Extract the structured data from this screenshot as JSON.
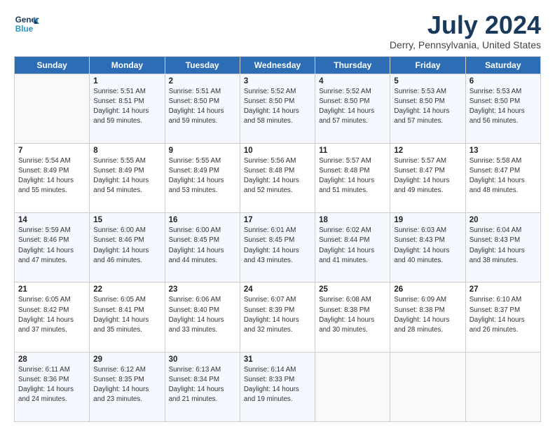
{
  "logo": {
    "line1": "General",
    "line2": "Blue"
  },
  "title": "July 2024",
  "subtitle": "Derry, Pennsylvania, United States",
  "days_of_week": [
    "Sunday",
    "Monday",
    "Tuesday",
    "Wednesday",
    "Thursday",
    "Friday",
    "Saturday"
  ],
  "weeks": [
    [
      {
        "num": "",
        "info": ""
      },
      {
        "num": "1",
        "info": "Sunrise: 5:51 AM\nSunset: 8:51 PM\nDaylight: 14 hours\nand 59 minutes."
      },
      {
        "num": "2",
        "info": "Sunrise: 5:51 AM\nSunset: 8:50 PM\nDaylight: 14 hours\nand 59 minutes."
      },
      {
        "num": "3",
        "info": "Sunrise: 5:52 AM\nSunset: 8:50 PM\nDaylight: 14 hours\nand 58 minutes."
      },
      {
        "num": "4",
        "info": "Sunrise: 5:52 AM\nSunset: 8:50 PM\nDaylight: 14 hours\nand 57 minutes."
      },
      {
        "num": "5",
        "info": "Sunrise: 5:53 AM\nSunset: 8:50 PM\nDaylight: 14 hours\nand 57 minutes."
      },
      {
        "num": "6",
        "info": "Sunrise: 5:53 AM\nSunset: 8:50 PM\nDaylight: 14 hours\nand 56 minutes."
      }
    ],
    [
      {
        "num": "7",
        "info": "Sunrise: 5:54 AM\nSunset: 8:49 PM\nDaylight: 14 hours\nand 55 minutes."
      },
      {
        "num": "8",
        "info": "Sunrise: 5:55 AM\nSunset: 8:49 PM\nDaylight: 14 hours\nand 54 minutes."
      },
      {
        "num": "9",
        "info": "Sunrise: 5:55 AM\nSunset: 8:49 PM\nDaylight: 14 hours\nand 53 minutes."
      },
      {
        "num": "10",
        "info": "Sunrise: 5:56 AM\nSunset: 8:48 PM\nDaylight: 14 hours\nand 52 minutes."
      },
      {
        "num": "11",
        "info": "Sunrise: 5:57 AM\nSunset: 8:48 PM\nDaylight: 14 hours\nand 51 minutes."
      },
      {
        "num": "12",
        "info": "Sunrise: 5:57 AM\nSunset: 8:47 PM\nDaylight: 14 hours\nand 49 minutes."
      },
      {
        "num": "13",
        "info": "Sunrise: 5:58 AM\nSunset: 8:47 PM\nDaylight: 14 hours\nand 48 minutes."
      }
    ],
    [
      {
        "num": "14",
        "info": "Sunrise: 5:59 AM\nSunset: 8:46 PM\nDaylight: 14 hours\nand 47 minutes."
      },
      {
        "num": "15",
        "info": "Sunrise: 6:00 AM\nSunset: 8:46 PM\nDaylight: 14 hours\nand 46 minutes."
      },
      {
        "num": "16",
        "info": "Sunrise: 6:00 AM\nSunset: 8:45 PM\nDaylight: 14 hours\nand 44 minutes."
      },
      {
        "num": "17",
        "info": "Sunrise: 6:01 AM\nSunset: 8:45 PM\nDaylight: 14 hours\nand 43 minutes."
      },
      {
        "num": "18",
        "info": "Sunrise: 6:02 AM\nSunset: 8:44 PM\nDaylight: 14 hours\nand 41 minutes."
      },
      {
        "num": "19",
        "info": "Sunrise: 6:03 AM\nSunset: 8:43 PM\nDaylight: 14 hours\nand 40 minutes."
      },
      {
        "num": "20",
        "info": "Sunrise: 6:04 AM\nSunset: 8:43 PM\nDaylight: 14 hours\nand 38 minutes."
      }
    ],
    [
      {
        "num": "21",
        "info": "Sunrise: 6:05 AM\nSunset: 8:42 PM\nDaylight: 14 hours\nand 37 minutes."
      },
      {
        "num": "22",
        "info": "Sunrise: 6:05 AM\nSunset: 8:41 PM\nDaylight: 14 hours\nand 35 minutes."
      },
      {
        "num": "23",
        "info": "Sunrise: 6:06 AM\nSunset: 8:40 PM\nDaylight: 14 hours\nand 33 minutes."
      },
      {
        "num": "24",
        "info": "Sunrise: 6:07 AM\nSunset: 8:39 PM\nDaylight: 14 hours\nand 32 minutes."
      },
      {
        "num": "25",
        "info": "Sunrise: 6:08 AM\nSunset: 8:38 PM\nDaylight: 14 hours\nand 30 minutes."
      },
      {
        "num": "26",
        "info": "Sunrise: 6:09 AM\nSunset: 8:38 PM\nDaylight: 14 hours\nand 28 minutes."
      },
      {
        "num": "27",
        "info": "Sunrise: 6:10 AM\nSunset: 8:37 PM\nDaylight: 14 hours\nand 26 minutes."
      }
    ],
    [
      {
        "num": "28",
        "info": "Sunrise: 6:11 AM\nSunset: 8:36 PM\nDaylight: 14 hours\nand 24 minutes."
      },
      {
        "num": "29",
        "info": "Sunrise: 6:12 AM\nSunset: 8:35 PM\nDaylight: 14 hours\nand 23 minutes."
      },
      {
        "num": "30",
        "info": "Sunrise: 6:13 AM\nSunset: 8:34 PM\nDaylight: 14 hours\nand 21 minutes."
      },
      {
        "num": "31",
        "info": "Sunrise: 6:14 AM\nSunset: 8:33 PM\nDaylight: 14 hours\nand 19 minutes."
      },
      {
        "num": "",
        "info": ""
      },
      {
        "num": "",
        "info": ""
      },
      {
        "num": "",
        "info": ""
      }
    ]
  ]
}
